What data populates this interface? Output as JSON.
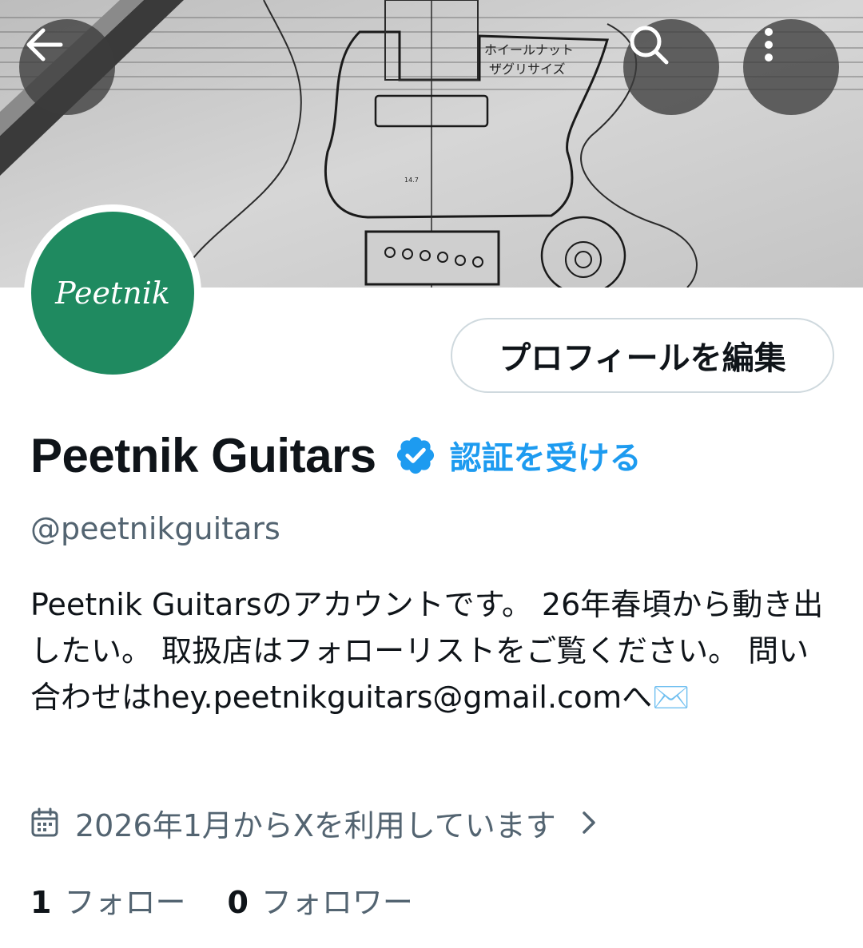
{
  "header": {
    "back_icon": "arrow-left-icon",
    "search_icon": "search-icon",
    "more_icon": "more-vertical-icon"
  },
  "banner": {
    "sketch_texts": [
      "ホイールナット",
      "ザグリサイズ",
      "14.7"
    ]
  },
  "avatar": {
    "text": "Peetnik",
    "bg_color": "#1f8a60"
  },
  "profile": {
    "edit_button": "プロフィールを編集",
    "display_name": "Peetnik Guitars",
    "verified_icon": "verified-badge-icon",
    "get_verified": "認証を受ける",
    "handle": "@peetnikguitars",
    "bio": "Peetnik Guitarsのアカウントです。 26年春頃から動き出したい。 取扱店はフォローリストをご覧ください。 問い合わせはhey.peetnikguitars@gmail.comへ✉️",
    "joined": "2026年1月からXを利用しています",
    "following_count": "1",
    "following_label": "フォロー",
    "followers_count": "0",
    "followers_label": "フォロワー"
  },
  "colors": {
    "accent": "#1d9bf0",
    "secondary_text": "#536471",
    "primary_text": "#0f1419",
    "border": "#cfd9de"
  }
}
